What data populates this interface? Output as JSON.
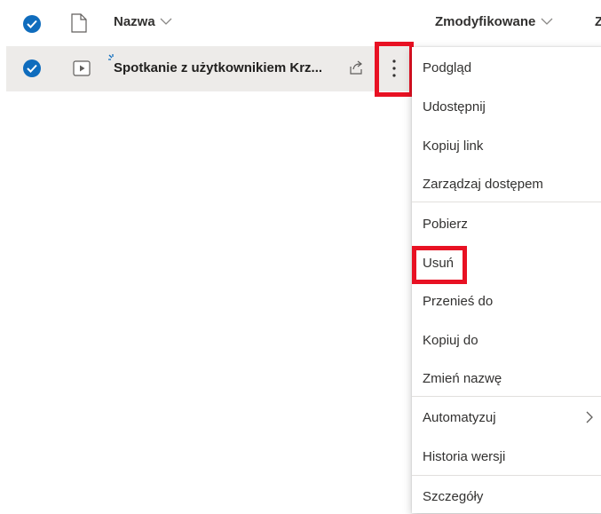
{
  "header": {
    "name_label": "Nazwa",
    "modified_label": "Zmodyfikowane",
    "cut_label": "Z"
  },
  "row": {
    "file_name": "Spotkanie z użytkownikiem Krz..."
  },
  "menu": {
    "items": [
      {
        "label": "Podgląd"
      },
      {
        "label": "Udostępnij"
      },
      {
        "label": "Kopiuj link"
      },
      {
        "label": "Zarządzaj dostępem"
      },
      {
        "label": "Pobierz"
      },
      {
        "label": "Usuń"
      },
      {
        "label": "Przenieś do"
      },
      {
        "label": "Kopiuj do"
      },
      {
        "label": "Zmień nazwę"
      },
      {
        "label": "Automatyzuj"
      },
      {
        "label": "Historia wersji"
      },
      {
        "label": "Szczegóły"
      }
    ]
  },
  "colors": {
    "accent": "#0f6cbd",
    "highlight": "#e81123",
    "selected_row": "#edebe9"
  }
}
